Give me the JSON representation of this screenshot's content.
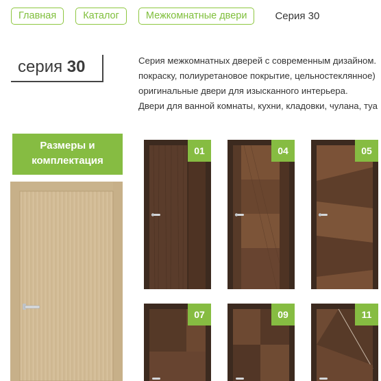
{
  "breadcrumb": {
    "items": [
      {
        "label": "Главная"
      },
      {
        "label": "Каталог"
      },
      {
        "label": "Межкомнатные двери"
      }
    ],
    "current": "Серия 30"
  },
  "series": {
    "prefix": "серия",
    "number": "30"
  },
  "description": {
    "lines": [
      "Серия межкомнатных дверей с современным дизайном. ",
      "покраску, полиуретановое покрытие, цельностеклянное)",
      "оригинальные двери для изысканного интерьера.",
      "Двери для ванной комнаты, кухни, кладовки, чулана, туа"
    ]
  },
  "size_button": {
    "line1": "Размеры и",
    "line2": "комплектация"
  },
  "doors": [
    {
      "number": "01"
    },
    {
      "number": "04"
    },
    {
      "number": "05"
    },
    {
      "number": "07"
    },
    {
      "number": "09"
    },
    {
      "number": "11"
    }
  ]
}
